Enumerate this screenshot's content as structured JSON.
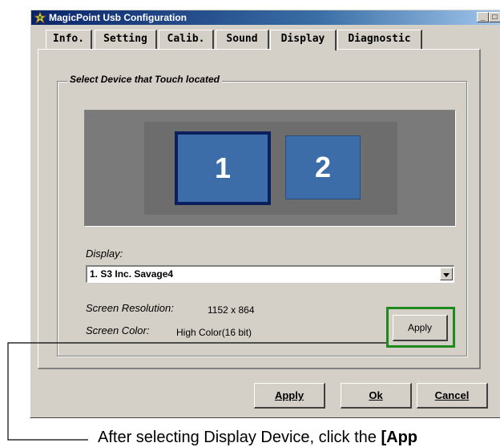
{
  "window": {
    "title": "MagicPoint Usb Configuration"
  },
  "title_buttons": {
    "minimize": "_",
    "maximize": "□",
    "close": "X"
  },
  "tabs": [
    {
      "label": "Info."
    },
    {
      "label": "Setting"
    },
    {
      "label": "Calib."
    },
    {
      "label": "Sound"
    },
    {
      "label": "Display",
      "active": true
    },
    {
      "label": "Diagnostic"
    }
  ],
  "group": {
    "title": "Select Device that Touch located"
  },
  "monitors": [
    {
      "label": "1",
      "selected": true
    },
    {
      "label": "2",
      "selected": false
    }
  ],
  "display": {
    "label": "Display:",
    "selected_value": "1. S3 Inc. Savage4",
    "resolution_label": "Screen Resolution:",
    "resolution_value": "1152 x 864",
    "color_label": "Screen Color:",
    "color_value": "High Color(16 bit)",
    "apply_label": "Apply"
  },
  "footer": {
    "apply_label": "Apply",
    "ok_label": "Ok",
    "cancel_label": "Cancel"
  },
  "caption": {
    "prefix": "After selecting Display Device, click the ",
    "bold": "[App"
  },
  "colors": {
    "highlight_box": "#1e8a1e",
    "monitor_fill": "#3c6da8",
    "selected_border": "#0a1f5c",
    "window_face": "#d4d0c8"
  }
}
